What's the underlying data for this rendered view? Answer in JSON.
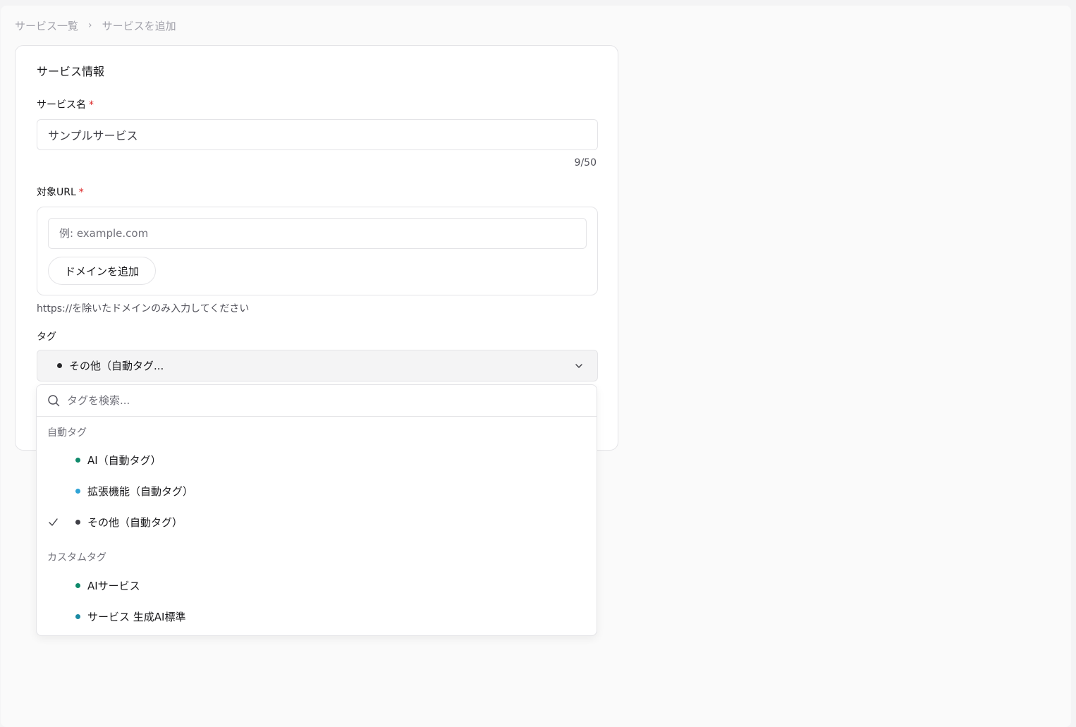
{
  "breadcrumb": {
    "root": "サービス一覧",
    "separator": "›",
    "current": "サービスを追加"
  },
  "card": {
    "title": "サービス情報"
  },
  "service_name": {
    "label": "サービス名",
    "required_mark": "*",
    "value": "サンプルサービス",
    "counter": "9/50"
  },
  "target_url": {
    "label": "対象URL",
    "required_mark": "*",
    "placeholder": "例: example.com",
    "add_button": "ドメインを追加",
    "hint": "https://を除いたドメインのみ入力してください"
  },
  "tags": {
    "label": "タグ",
    "selected_display": "その他（自動タグ...",
    "selected_color": "#27272a",
    "search_placeholder": "タグを検索...",
    "groups": [
      {
        "label": "自動タグ",
        "options": [
          {
            "label": "AI（自動タグ）",
            "color": "#0f8a6b",
            "selected": false
          },
          {
            "label": "拡張機能（自動タグ）",
            "color": "#2ea3d6",
            "selected": false
          },
          {
            "label": "その他（自動タグ）",
            "color": "#3f3f46",
            "selected": true
          }
        ]
      },
      {
        "label": "カスタムタグ",
        "options": [
          {
            "label": "AIサービス",
            "color": "#0f8a6b",
            "selected": false
          },
          {
            "label": "サービス 生成AI標準",
            "color": "#1b8aa3",
            "selected": false
          }
        ]
      }
    ]
  }
}
